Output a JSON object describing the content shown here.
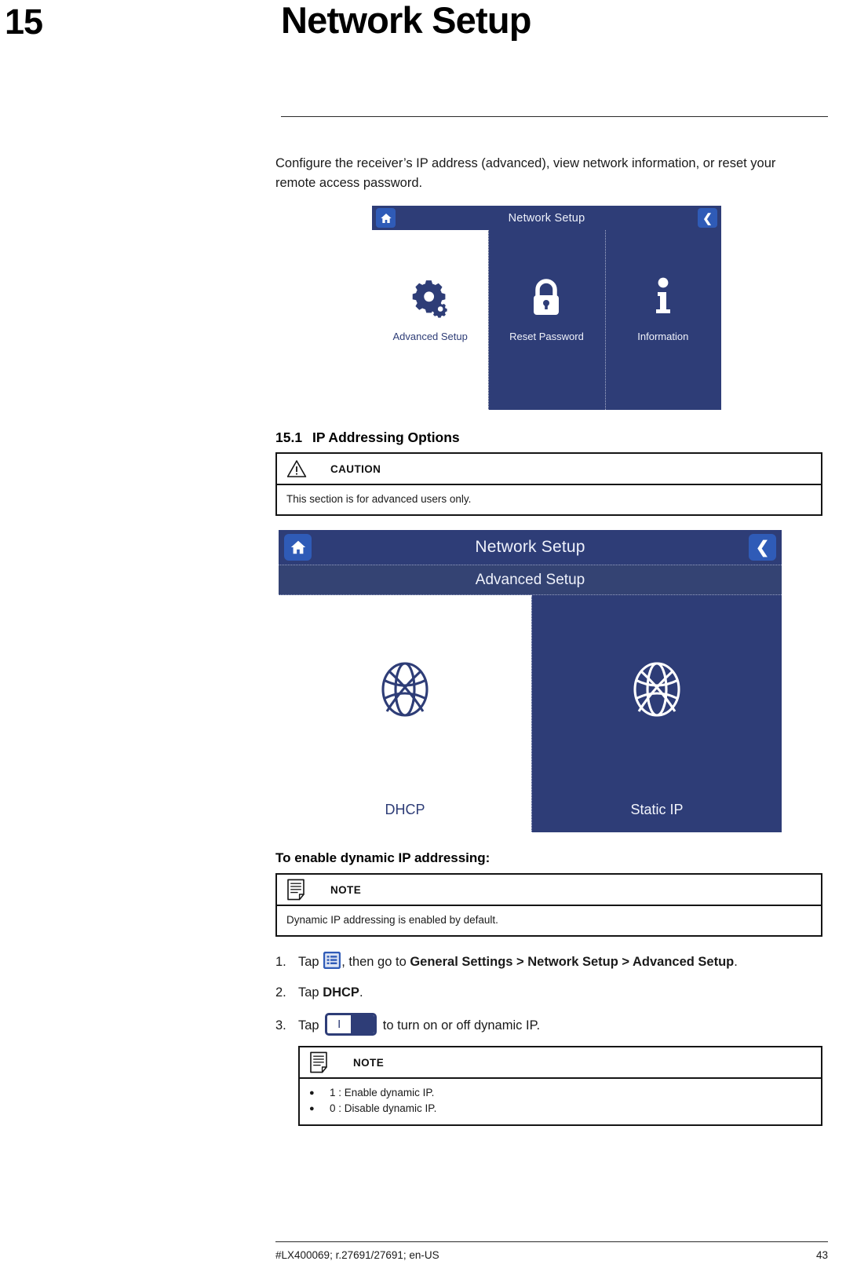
{
  "chapter": {
    "number": "15",
    "title": "Network Setup"
  },
  "intro": "Configure the receiver’s IP address (advanced), view network information, or reset your remote access password.",
  "screenshot_network_setup": {
    "home_icon": "home-icon",
    "title": "Network Setup",
    "back_icon": "back-chevron-icon",
    "tiles": [
      {
        "label": "Advanced Setup",
        "icon": "gears-icon",
        "selected": true
      },
      {
        "label": "Reset Password",
        "icon": "lock-icon",
        "selected": false
      },
      {
        "label": "Information",
        "icon": "info-icon",
        "selected": false
      }
    ]
  },
  "section": {
    "number": "15.1",
    "title": "IP Addressing Options"
  },
  "caution_box": {
    "kind": "CAUTION",
    "icon": "warning-triangle-icon",
    "text": "This section is for advanced users only."
  },
  "screenshot_advanced_setup": {
    "home_icon": "home-icon",
    "title": "Network Setup",
    "back_icon": "back-chevron-icon",
    "subtitle": "Advanced Setup",
    "panes": [
      {
        "label": "DHCP",
        "icon": "globe-icon",
        "selected": true
      },
      {
        "label": "Static IP",
        "icon": "globe-icon",
        "selected": false
      }
    ]
  },
  "procedure": {
    "title": "To enable dynamic IP addressing:",
    "note_box": {
      "kind": "NOTE",
      "icon": "note-page-icon",
      "text": "Dynamic IP addressing is enabled by default."
    },
    "steps": [
      {
        "number": "1.",
        "prefix": "Tap ",
        "icon": "menu-list-icon",
        "middle": ", then go to ",
        "bold": "General Settings > Network Setup > Advanced Setup",
        "suffix": "."
      },
      {
        "number": "2.",
        "prefix": "Tap ",
        "bold": "DHCP",
        "suffix": "."
      },
      {
        "number": "3.",
        "prefix": "Tap ",
        "icon": "toggle-switch-icon",
        "toggle_on_label": "I",
        "suffix": " to turn on or off dynamic IP."
      }
    ],
    "note_box_2": {
      "kind": "NOTE",
      "icon": "note-page-icon",
      "bullets": [
        "1 : Enable dynamic IP.",
        "0 : Disable dynamic IP."
      ]
    }
  },
  "footer": {
    "document_id": "#LX400069; r.27691/27691; en-US",
    "page_number": "43"
  },
  "colors": {
    "device_blue": "#2e3d77",
    "device_button_blue": "#2f5bb7",
    "ink": "#1a1a1a"
  }
}
